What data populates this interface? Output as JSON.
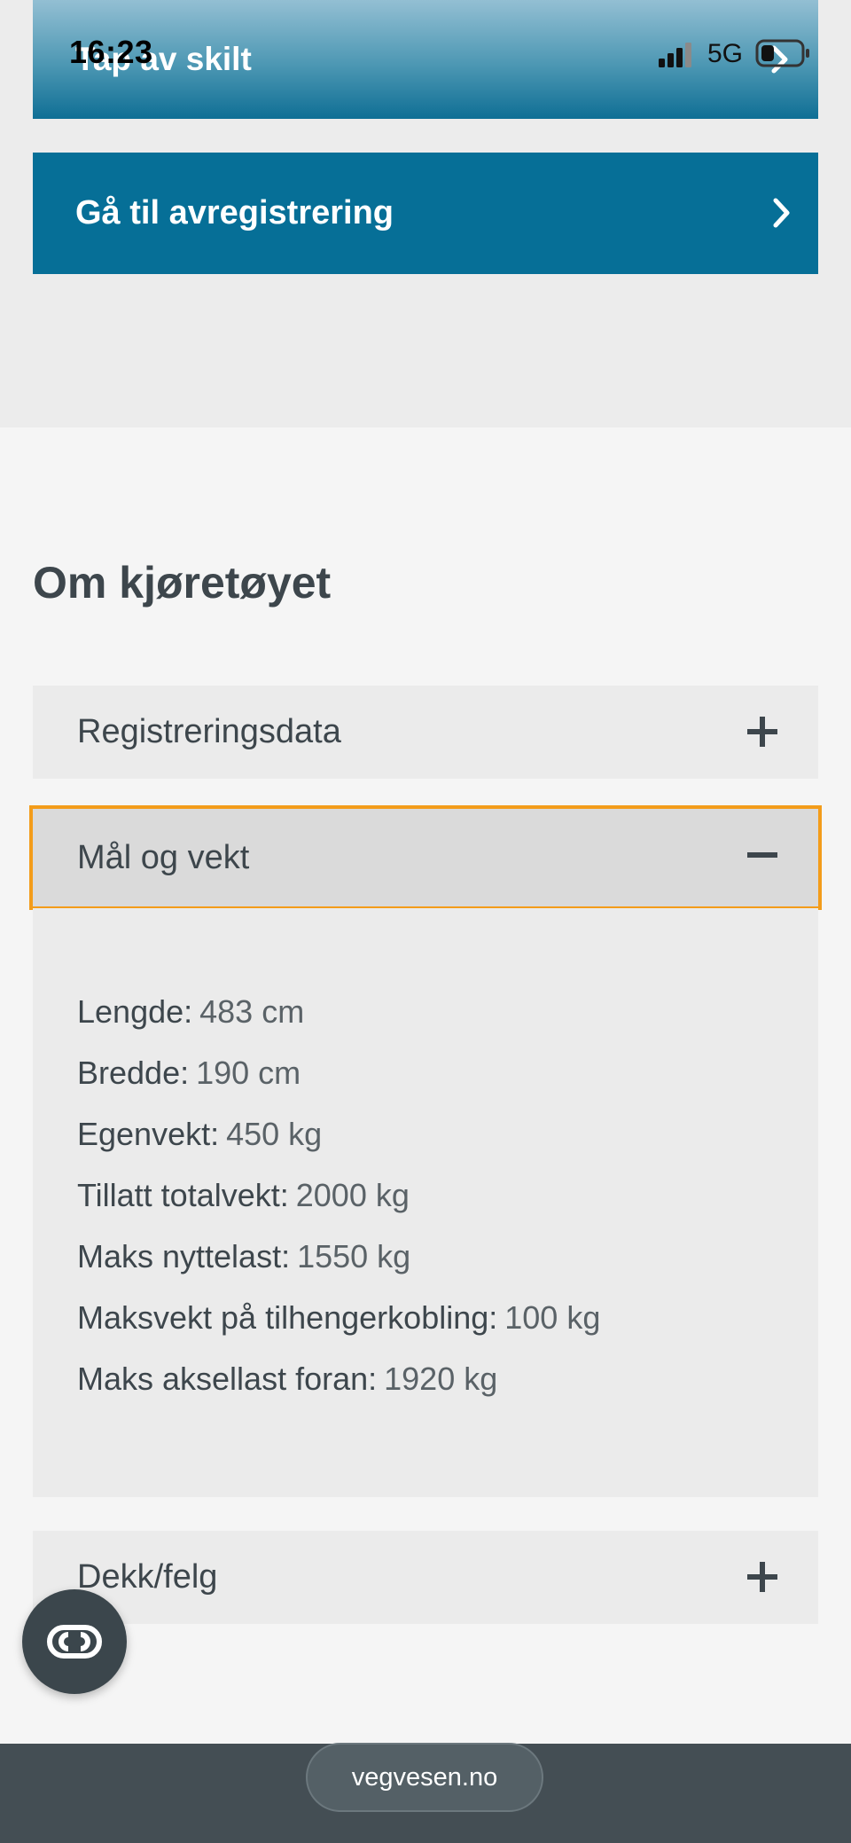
{
  "status_bar": {
    "time": "16:23",
    "network": "5G"
  },
  "header_button": {
    "label": "Tap av skilt"
  },
  "primary_button": {
    "label": "Gå til avregistrering"
  },
  "section": {
    "title": "Om kjøretøyet"
  },
  "accordion": {
    "items": [
      {
        "label": "Registreringsdata",
        "expanded": false
      },
      {
        "label": "Mål og vekt",
        "expanded": true
      },
      {
        "label": "Dekk/felg",
        "expanded": false
      }
    ],
    "specs": [
      {
        "label": "Lengde:",
        "value": "483 cm"
      },
      {
        "label": "Bredde:",
        "value": "190 cm"
      },
      {
        "label": "Egenvekt:",
        "value": "450 kg"
      },
      {
        "label": "Tillatt totalvekt:",
        "value": "2000 kg"
      },
      {
        "label": "Maks nyttelast:",
        "value": "1550 kg"
      },
      {
        "label": "Maksvekt på tilhengerkobling:",
        "value": "100 kg"
      },
      {
        "label": "Maks aksellast foran:",
        "value": "1920 kg"
      }
    ]
  },
  "chat_button": {
    "icon": "chat-icon"
  },
  "browser": {
    "url": "vegvesen.no"
  },
  "colors": {
    "primary": "#066f97",
    "focus_outline": "#f39c1a",
    "text": "#3d464c",
    "browser_bar": "#444e54"
  }
}
